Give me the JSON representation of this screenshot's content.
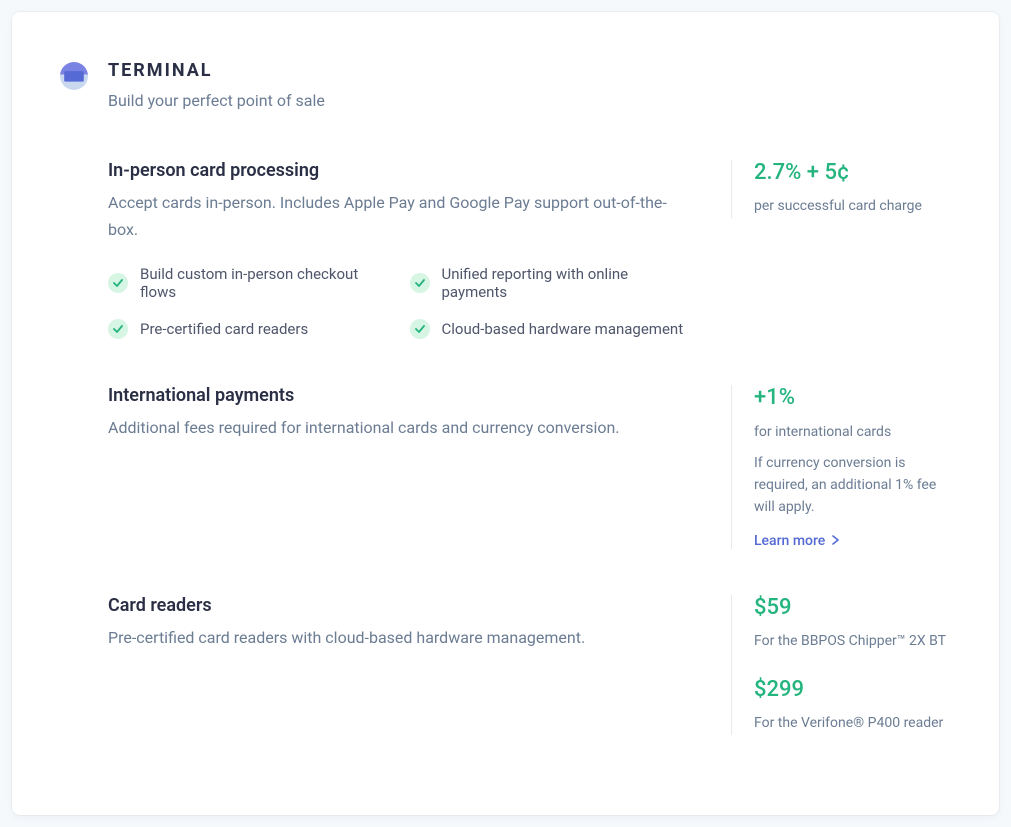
{
  "header": {
    "title": "TERMINAL",
    "subtitle": "Build your perfect point of sale"
  },
  "sections": {
    "processing": {
      "title": "In-person card processing",
      "desc": "Accept cards in-person. Includes Apple Pay and Google Pay support out-of-the-box.",
      "features": [
        "Build custom in-person checkout flows",
        "Unified reporting with online payments",
        "Pre-certified card readers",
        "Cloud-based hardware management"
      ],
      "price": "2.7% + 5¢",
      "price_sub": "per successful card charge"
    },
    "international": {
      "title": "International payments",
      "desc": "Additional fees required for international cards and currency conversion.",
      "price": "+1%",
      "price_sub1": "for international cards",
      "price_sub2": "If currency conversion is required, an additional 1% fee will apply.",
      "learn_more": "Learn more"
    },
    "readers": {
      "title": "Card readers",
      "desc": "Pre-certified card readers with cloud-based hardware management.",
      "price1": "$59",
      "price1_sub": "For the BBPOS Chipper™ 2X BT",
      "price2": "$299",
      "price2_sub": "For the Verifone® P400 reader"
    }
  }
}
